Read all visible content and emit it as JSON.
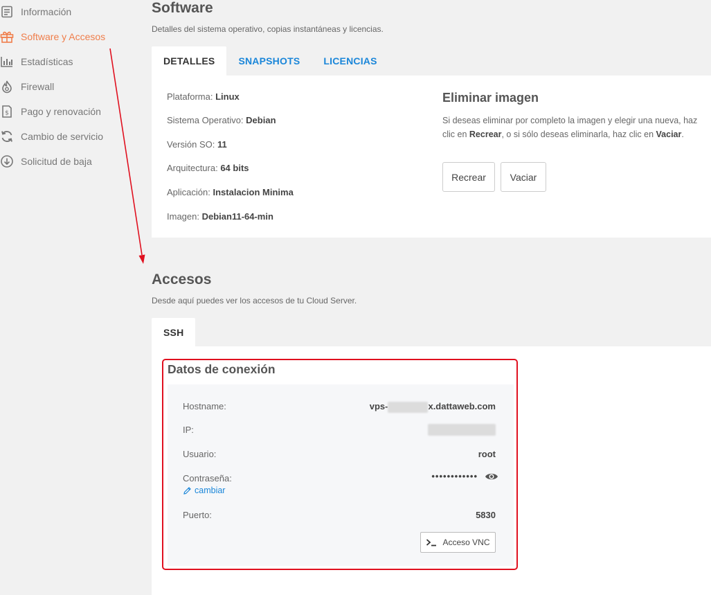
{
  "sidebar": {
    "items": [
      {
        "label": "Información",
        "icon": "info-doc-icon",
        "active": false
      },
      {
        "label": "Software y Accesos",
        "icon": "gift-icon",
        "active": true
      },
      {
        "label": "Estadísticas",
        "icon": "bar-chart-icon",
        "active": false
      },
      {
        "label": "Firewall",
        "icon": "flame-icon",
        "active": false
      },
      {
        "label": "Pago y renovación",
        "icon": "invoice-dollar-icon",
        "active": false
      },
      {
        "label": "Cambio de servicio",
        "icon": "refresh-icon",
        "active": false
      },
      {
        "label": "Solicitud de baja",
        "icon": "download-circle-icon",
        "active": false
      }
    ]
  },
  "software": {
    "title": "Software",
    "subtitle": "Detalles del sistema operativo, copias instantáneas y licencias.",
    "tabs": [
      "DETALLES",
      "SNAPSHOTS",
      "LICENCIAS"
    ],
    "details": [
      {
        "label": "Plataforma:",
        "value": "Linux"
      },
      {
        "label": "Sistema Operativo:",
        "value": "Debian"
      },
      {
        "label": "Versión SO:",
        "value": "11"
      },
      {
        "label": "Arquitectura:",
        "value": "64 bits"
      },
      {
        "label": "Aplicación:",
        "value": "Instalacion Minima"
      },
      {
        "label": "Imagen:",
        "value": "Debian11-64-min"
      }
    ],
    "delete": {
      "title": "Eliminar imagen",
      "text_1": "Si deseas eliminar por completo la imagen y elegir una nueva, haz clic en ",
      "bold_1": "Recrear",
      "text_2": ", o si sólo deseas eliminarla, haz clic en ",
      "bold_2": "Vaciar",
      "text_3": ".",
      "recreate_label": "Recrear",
      "empty_label": "Vaciar"
    }
  },
  "accesos": {
    "title": "Accesos",
    "subtitle": "Desde aquí puedes ver los accesos de tu Cloud Server.",
    "tabs": [
      "SSH"
    ],
    "connection": {
      "title": "Datos de conexión",
      "hostname_label": "Hostname:",
      "hostname_prefix": "vps-",
      "hostname_suffix": "x.dattaweb.com",
      "ip_label": "IP:",
      "user_label": "Usuario:",
      "user_value": "root",
      "password_label": "Contraseña:",
      "password_value": "••••••••••••",
      "change_label": "cambiar",
      "port_label": "Puerto:",
      "port_value": "5830",
      "vnc_label": "Acceso VNC"
    }
  },
  "colors": {
    "active": "#f07e4b",
    "link": "#1a86d9",
    "annotation": "#e0101f"
  }
}
